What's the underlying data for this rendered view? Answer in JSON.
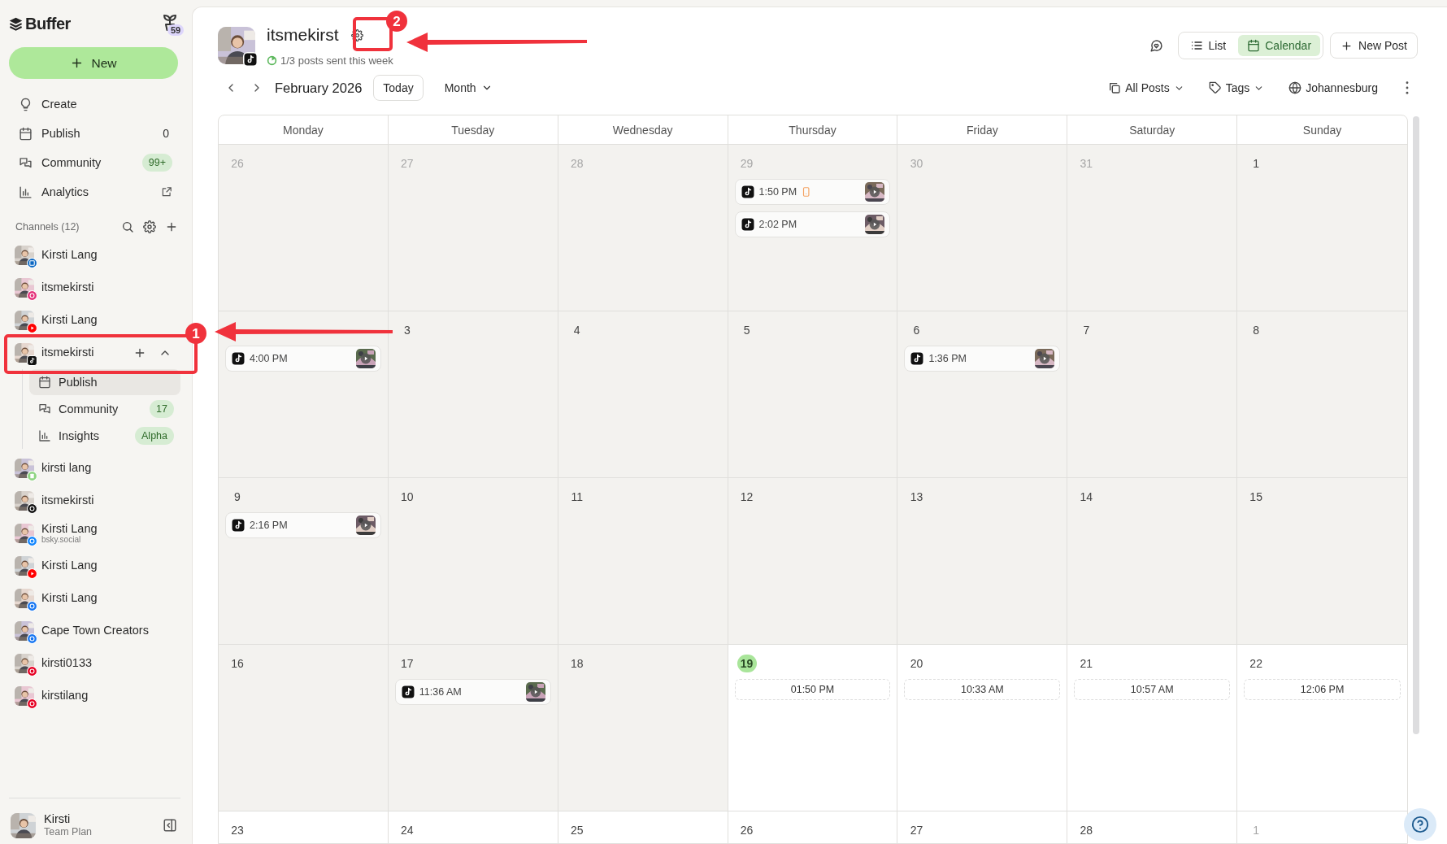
{
  "sidebar": {
    "logo": "Buffer",
    "plant_badge": "59",
    "new_button": "New",
    "nav": [
      {
        "label": "Create",
        "kind": "create",
        "external": false
      },
      {
        "label": "Publish",
        "kind": "publish",
        "count": "0",
        "external": false
      },
      {
        "label": "Community",
        "kind": "community",
        "badge": "99+",
        "external": false
      },
      {
        "label": "Analytics",
        "kind": "analytics",
        "external": true
      }
    ],
    "channels_title": "Channels (12)",
    "channels": [
      {
        "name": "Kirsti Lang",
        "kind": "linkedin",
        "expanded": false
      },
      {
        "name": "itsmekirsti",
        "kind": "instagram",
        "expanded": false
      },
      {
        "name": "Kirsti Lang",
        "kind": "youtube",
        "expanded": false
      },
      {
        "name": "itsmekirsti",
        "kind": "tiktok",
        "expanded": true,
        "children": [
          {
            "label": "Publish",
            "kind": "publish",
            "selected": true
          },
          {
            "label": "Community",
            "kind": "community",
            "badge": "17",
            "selected": false
          },
          {
            "label": "Insights",
            "kind": "analytics",
            "badge": "Alpha",
            "selected": false
          }
        ]
      },
      {
        "name": "kirsti lang",
        "kind": "startpage",
        "expanded": false
      },
      {
        "name": "itsmekirsti",
        "kind": "threads",
        "expanded": false
      },
      {
        "name": "Kirsti Lang",
        "handle": "bsky.social",
        "kind": "bluesky",
        "expanded": false
      },
      {
        "name": "Kirsti Lang",
        "kind": "youtube",
        "expanded": false
      },
      {
        "name": "Kirsti Lang",
        "kind": "facebook",
        "expanded": false
      },
      {
        "name": "Cape Town Creators",
        "kind": "facebook",
        "expanded": false
      },
      {
        "name": "kirsti0133",
        "kind": "pinterest",
        "expanded": false
      },
      {
        "name": "kirstilang",
        "kind": "pinterest",
        "expanded": false
      }
    ],
    "user": {
      "name": "Kirsti",
      "plan": "Team Plan"
    }
  },
  "header": {
    "channel": "itsmekirst",
    "kind": "tiktok",
    "status": "1/3 posts sent this week",
    "view_tabs": [
      {
        "label": "List",
        "kind": "list",
        "selected": false
      },
      {
        "label": "Calendar",
        "kind": "calendar",
        "selected": true
      }
    ],
    "new_post": "New Post"
  },
  "toolbar": {
    "period": "February 2026",
    "today": "Today",
    "range": "Month",
    "filters": [
      {
        "label": "All Posts",
        "kind": "posts",
        "dropdown": true
      },
      {
        "label": "Tags",
        "kind": "tags",
        "dropdown": true
      },
      {
        "label": "Johannesburg",
        "kind": "timezone",
        "dropdown": false
      }
    ]
  },
  "calendar": {
    "weekdays": [
      "Monday",
      "Tuesday",
      "Wednesday",
      "Thursday",
      "Friday",
      "Saturday",
      "Sunday"
    ],
    "weeks": [
      {
        "days": [
          {
            "day": "26",
            "muted": true,
            "past": true,
            "today": false
          },
          {
            "day": "27",
            "muted": true,
            "past": true,
            "today": false
          },
          {
            "day": "28",
            "muted": true,
            "past": true,
            "today": false
          },
          {
            "day": "29",
            "muted": true,
            "past": true,
            "today": false,
            "posts": [
              {
                "kind": "post",
                "time": "1:50 PM",
                "alert": true
              },
              {
                "kind": "post",
                "time": "2:02 PM",
                "alert": false
              }
            ]
          },
          {
            "day": "30",
            "muted": true,
            "past": true,
            "today": false
          },
          {
            "day": "31",
            "muted": true,
            "past": true,
            "today": false
          },
          {
            "day": "1",
            "muted": false,
            "past": true,
            "today": false
          }
        ]
      },
      {
        "days": [
          {
            "muted": false,
            "past": true,
            "today": false,
            "posts": [
              {
                "kind": "post",
                "time": "4:00 PM",
                "alert": false
              }
            ]
          },
          {
            "day": "3",
            "muted": false,
            "past": true,
            "today": false
          },
          {
            "day": "4",
            "muted": false,
            "past": true,
            "today": false
          },
          {
            "day": "5",
            "muted": false,
            "past": true,
            "today": false
          },
          {
            "day": "6",
            "muted": false,
            "past": true,
            "today": false,
            "posts": [
              {
                "kind": "post",
                "time": "1:36 PM",
                "alert": false
              }
            ]
          },
          {
            "day": "7",
            "muted": false,
            "past": true,
            "today": false
          },
          {
            "day": "8",
            "muted": false,
            "past": true,
            "today": false
          }
        ]
      },
      {
        "days": [
          {
            "day": "9",
            "muted": false,
            "past": true,
            "today": false,
            "posts": [
              {
                "kind": "post",
                "time": "2:16 PM",
                "alert": false
              }
            ]
          },
          {
            "day": "10",
            "muted": false,
            "past": true,
            "today": false
          },
          {
            "day": "11",
            "muted": false,
            "past": true,
            "today": false
          },
          {
            "day": "12",
            "muted": false,
            "past": true,
            "today": false
          },
          {
            "day": "13",
            "muted": false,
            "past": true,
            "today": false
          },
          {
            "day": "14",
            "muted": false,
            "past": true,
            "today": false
          },
          {
            "day": "15",
            "muted": false,
            "past": true,
            "today": false
          }
        ]
      },
      {
        "days": [
          {
            "day": "16",
            "muted": false,
            "past": true,
            "today": false
          },
          {
            "day": "17",
            "muted": false,
            "past": true,
            "today": false,
            "posts": [
              {
                "kind": "post",
                "time": "11:36 AM",
                "alert": false
              }
            ]
          },
          {
            "day": "18",
            "muted": false,
            "past": true,
            "today": false
          },
          {
            "day": "19",
            "muted": false,
            "past": false,
            "today": true,
            "posts": [
              {
                "kind": "slot",
                "time": "01:50 PM"
              }
            ]
          },
          {
            "day": "20",
            "muted": false,
            "past": false,
            "today": false,
            "posts": [
              {
                "kind": "slot",
                "time": "10:33 AM"
              }
            ]
          },
          {
            "day": "21",
            "muted": false,
            "past": false,
            "today": false,
            "posts": [
              {
                "kind": "slot",
                "time": "10:57 AM"
              }
            ]
          },
          {
            "day": "22",
            "muted": false,
            "past": false,
            "today": false,
            "posts": [
              {
                "kind": "slot",
                "time": "12:06 PM"
              }
            ]
          }
        ]
      },
      {
        "days": [
          {
            "day": "23",
            "muted": false,
            "past": false,
            "today": false
          },
          {
            "day": "24",
            "muted": false,
            "past": false,
            "today": false
          },
          {
            "day": "25",
            "muted": false,
            "past": false,
            "today": false
          },
          {
            "day": "26",
            "muted": false,
            "past": false,
            "today": false
          },
          {
            "day": "27",
            "muted": false,
            "past": false,
            "today": false
          },
          {
            "day": "28",
            "muted": false,
            "past": false,
            "today": false
          },
          {
            "day": "1",
            "muted": true,
            "past": false,
            "today": false
          }
        ]
      }
    ]
  },
  "annotations": [
    {
      "label": "1"
    },
    {
      "label": "2"
    }
  ]
}
